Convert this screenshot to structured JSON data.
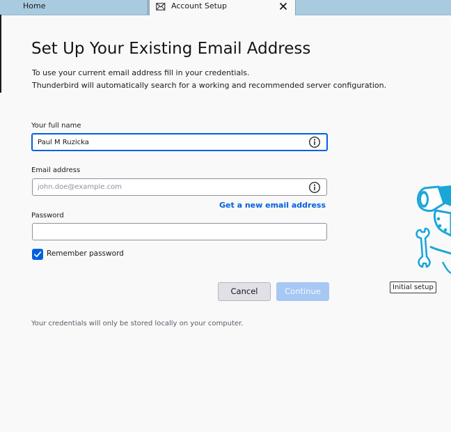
{
  "tabs": {
    "home_label": "Home",
    "active_label": "Account Setup",
    "active_icon": "envelope-icon",
    "close_icon": "close-icon"
  },
  "page": {
    "title": "Set Up Your Existing Email Address",
    "intro_line1": "To use your current email address fill in your credentials.",
    "intro_line2": "Thunderbird will automatically search for a working and recommended server configuration."
  },
  "form": {
    "full_name": {
      "label": "Your full name",
      "value": "Paul M Ruzicka",
      "placeholder": ""
    },
    "email": {
      "label": "Email address",
      "value": "",
      "placeholder": "john.doe@example.com"
    },
    "new_email_link": "Get a new email address",
    "password": {
      "label": "Password",
      "value": "",
      "placeholder": ""
    },
    "remember_password": {
      "label": "Remember password",
      "checked": true
    }
  },
  "buttons": {
    "cancel": "Cancel",
    "continue": "Continue"
  },
  "footer_note": "Your credentials will only be stored locally on your computer.",
  "tooltip": "Initial setup",
  "colors": {
    "accent": "#0060df",
    "tab_strip": "#a9cbe0",
    "continue_disabled": "#a6c8f3",
    "illustration": "#1aa7d8"
  }
}
